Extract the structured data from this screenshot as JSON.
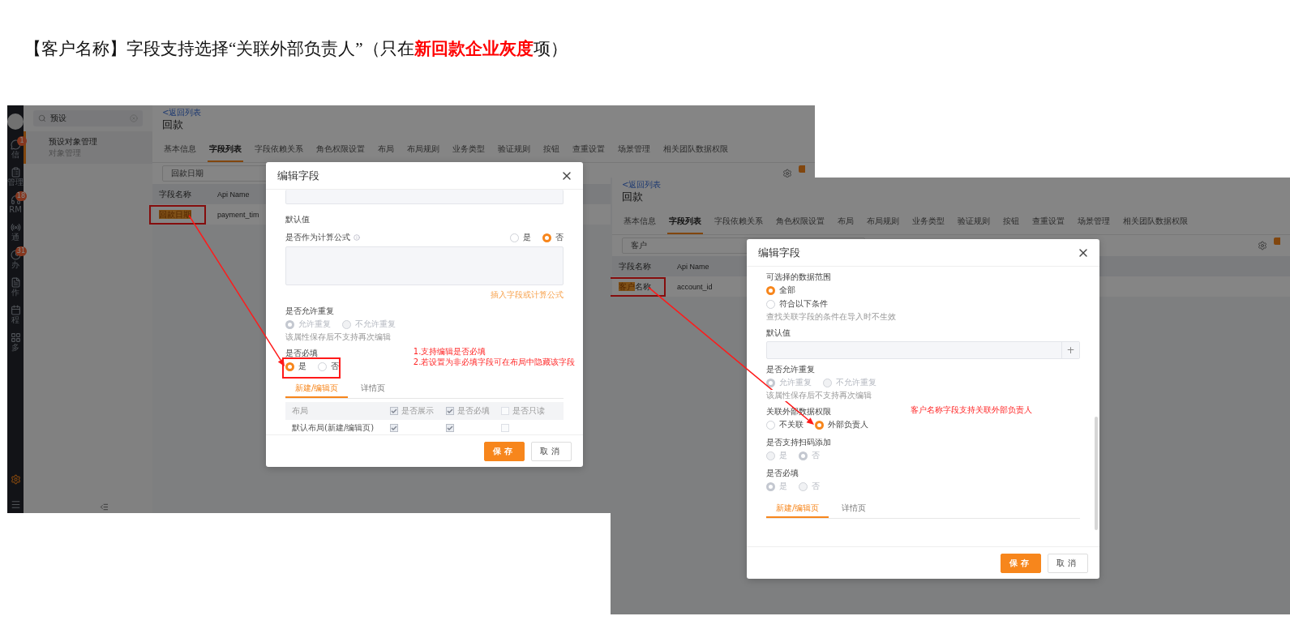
{
  "heading": "【客户名称】字段支持选择“关联外部负责人”（只在**新回款企业灰度**项）",
  "screenshots": [
    {
      "nav": {
        "items": [
          {
            "label": "信",
            "badge": "1"
          },
          {
            "label": "管理"
          },
          {
            "label": "RM",
            "badge": "18"
          },
          {
            "label": "通"
          },
          {
            "label": "办",
            "badge": "31"
          },
          {
            "label": "作"
          },
          {
            "label": "程"
          },
          {
            "label": "多"
          }
        ]
      },
      "side_panel": {
        "search": "预设",
        "items": [
          {
            "title": "预设对象管理",
            "subtitle": "对象管理",
            "selected": true
          }
        ]
      },
      "back_link": "<返回列表",
      "title": "回款",
      "tabs": [
        {
          "label": "基本信息",
          "selected": false
        },
        {
          "label": "字段列表",
          "selected": true
        },
        {
          "label": "字段依赖关系",
          "selected": false
        },
        {
          "label": "角色权限设置",
          "selected": false
        },
        {
          "label": "布局",
          "selected": false
        },
        {
          "label": "布局规则",
          "selected": false
        },
        {
          "label": "业务类型",
          "selected": false
        },
        {
          "label": "验证规则",
          "selected": false
        },
        {
          "label": "按钮",
          "selected": false
        },
        {
          "label": "查重设置",
          "selected": false
        },
        {
          "label": "场景管理",
          "selected": false
        },
        {
          "label": "相关团队数据权限",
          "selected": false
        }
      ],
      "search": "回款日期",
      "table": {
        "columns": [
          "字段名称",
          "Api Name"
        ],
        "rows": [
          {
            "cells": [
              {
                "highlight": "回款日期",
                "framed": true
              },
              {
                "text": "payment_tim"
              }
            ]
          }
        ]
      },
      "dialog": {
        "title": "编辑字段",
        "buttons": [
          "保存",
          "取消"
        ],
        "body": [
          {
            "kind": "textarea"
          },
          {
            "kind": "label",
            "text": "默认值"
          },
          {
            "kind": "label_radios",
            "text": "是否作为计算公式",
            "info": true,
            "options": [
              {
                "label": "是",
                "selected": false,
                "disabled": false
              },
              {
                "label": "否",
                "selected": true,
                "disabled": false
              }
            ]
          },
          {
            "kind": "textarea"
          },
          {
            "kind": "link",
            "text": "插入字段或计算公式"
          },
          {
            "kind": "label",
            "text": "是否允许重复"
          },
          {
            "kind": "radios",
            "options": [
              {
                "label": "允许重复",
                "selected": true,
                "disabled": true
              },
              {
                "label": "不允许重复",
                "selected": false,
                "disabled": true
              }
            ]
          },
          {
            "kind": "note",
            "text": "该属性保存后不支持再次编辑"
          },
          {
            "kind": "label",
            "text": "是否必填",
            "annotation": [
              "1.支持编辑是否必填",
              "2.若设置为非必填字段可在布局中隐藏该字段"
            ]
          },
          {
            "kind": "radios",
            "framed": true,
            "pointed": true,
            "options": [
              {
                "label": "是",
                "selected": true,
                "disabled": false
              },
              {
                "label": "否",
                "selected": false,
                "disabled": false
              }
            ]
          },
          {
            "kind": "tabs",
            "tabs": [
              {
                "label": "新建/编辑页",
                "selected": true
              },
              {
                "label": "详情页",
                "selected": false
              }
            ]
          },
          {
            "kind": "layout_table",
            "header": "布局",
            "columns": [
              {
                "label": "是否展示",
                "checked": true
              },
              {
                "label": "是否必填",
                "checked": true
              },
              {
                "label": "是否只读",
                "checked": false
              }
            ],
            "rows": [
              {
                "label": "默认布局(新建/编辑页)",
                "checks": [
                  true,
                  true,
                  false
                ]
              }
            ]
          }
        ]
      }
    },
    {
      "back_link": "<返回列表",
      "title": "回款",
      "tabs": [
        {
          "label": "基本信息",
          "selected": false
        },
        {
          "label": "字段列表",
          "selected": true
        },
        {
          "label": "字段依赖关系",
          "selected": false
        },
        {
          "label": "角色权限设置",
          "selected": false
        },
        {
          "label": "布局",
          "selected": false
        },
        {
          "label": "布局规则",
          "selected": false
        },
        {
          "label": "业务类型",
          "selected": false
        },
        {
          "label": "验证规则",
          "selected": false
        },
        {
          "label": "按钮",
          "selected": false
        },
        {
          "label": "查重设置",
          "selected": false
        },
        {
          "label": "场景管理",
          "selected": false
        },
        {
          "label": "相关团队数据权限",
          "selected": false
        }
      ],
      "search": "客户",
      "table": {
        "columns": [
          "字段名称",
          "Api Name"
        ],
        "rows": [
          {
            "cells": [
              {
                "highlight": "客户",
                "text": "名称",
                "framed": true
              },
              {
                "text": "account_id"
              }
            ]
          }
        ]
      },
      "dialog": {
        "title": "编辑字段",
        "buttons": [
          "保存",
          "取消"
        ],
        "body": [
          {
            "kind": "label",
            "text": "可选择的数据范围"
          },
          {
            "kind": "radio_column",
            "options": [
              {
                "label": "全部",
                "selected": true,
                "disabled": false
              },
              {
                "label": "符合以下条件",
                "selected": false,
                "disabled": false
              }
            ]
          },
          {
            "kind": "note",
            "text": "查找关联字段的条件在导入时不生效"
          },
          {
            "kind": "label",
            "text": "默认值"
          },
          {
            "kind": "input_plus",
            "button": "+"
          },
          {
            "kind": "label",
            "text": "是否允许重复"
          },
          {
            "kind": "radios",
            "options": [
              {
                "label": "允许重复",
                "selected": true,
                "disabled": true
              },
              {
                "label": "不允许重复",
                "selected": false,
                "disabled": true
              }
            ]
          },
          {
            "kind": "note",
            "text": "该属性保存后不支持再次编辑"
          },
          {
            "kind": "label",
            "text": "关联外部数据权限",
            "annotation": [
              "客户名称字段支持关联外部负责人"
            ]
          },
          {
            "kind": "radios",
            "pointed": true,
            "options": [
              {
                "label": "不关联",
                "selected": false,
                "disabled": false
              },
              {
                "label": "外部负责人",
                "selected": true,
                "disabled": false
              }
            ]
          },
          {
            "kind": "label",
            "text": "是否支持扫码添加"
          },
          {
            "kind": "radios",
            "options": [
              {
                "label": "是",
                "selected": false,
                "disabled": true
              },
              {
                "label": "否",
                "selected": true,
                "disabled": true
              }
            ]
          },
          {
            "kind": "label",
            "text": "是否必填"
          },
          {
            "kind": "radios",
            "options": [
              {
                "label": "是",
                "selected": true,
                "disabled": true
              },
              {
                "label": "否",
                "selected": false,
                "disabled": true
              }
            ]
          },
          {
            "kind": "tabs",
            "tabs": [
              {
                "label": "新建/编辑页",
                "selected": true
              },
              {
                "label": "详情页",
                "selected": false
              }
            ]
          }
        ]
      }
    }
  ]
}
